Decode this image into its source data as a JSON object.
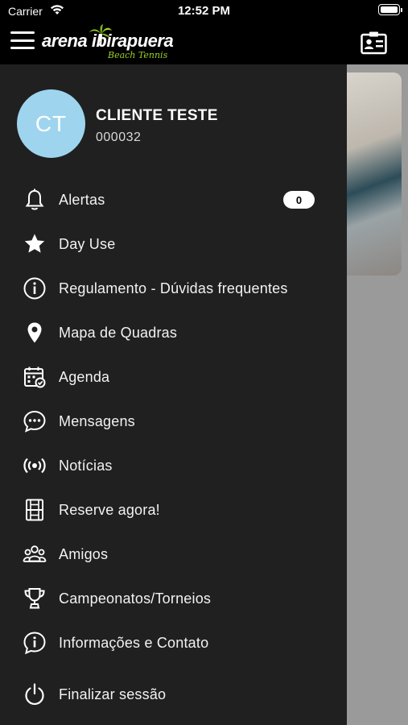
{
  "status_bar": {
    "carrier": "Carrier",
    "time": "12:52 PM"
  },
  "header": {
    "logo_main": "arena ibirapuera",
    "logo_sub": "Beach Tennis",
    "accent_color": "#9bd12a"
  },
  "user": {
    "initials": "CT",
    "name": "CLIENTE TESTE",
    "id": "000032",
    "avatar_color": "#9fd4ee"
  },
  "menu": [
    {
      "label": "Alertas",
      "icon": "bell-icon",
      "badge": "0"
    },
    {
      "label": "Day Use",
      "icon": "star-icon"
    },
    {
      "label": "Regulamento - Dúvidas frequentes",
      "icon": "info-icon"
    },
    {
      "label": "Mapa de Quadras",
      "icon": "map-pin-icon"
    },
    {
      "label": "Agenda",
      "icon": "calendar-icon"
    },
    {
      "label": "Mensagens",
      "icon": "chat-icon"
    },
    {
      "label": "Notícias",
      "icon": "broadcast-icon"
    },
    {
      "label": "Reserve agora!",
      "icon": "court-icon"
    },
    {
      "label": "Amigos",
      "icon": "friends-icon"
    },
    {
      "label": "Campeonatos/Torneios",
      "icon": "trophy-icon"
    },
    {
      "label": "Informações e Contato",
      "icon": "info-chat-icon"
    }
  ],
  "logout": {
    "label": "Finalizar sessão",
    "icon": "power-icon"
  }
}
